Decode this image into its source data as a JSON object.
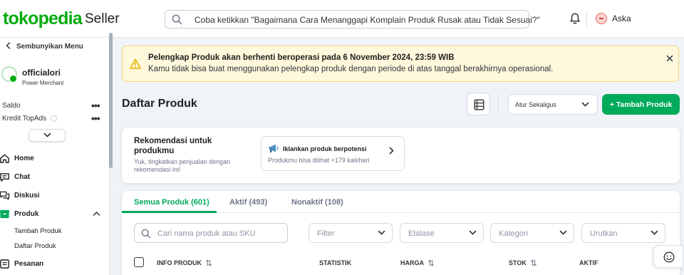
{
  "header": {
    "logo": "tokopedia",
    "logo_suffix": "Seller",
    "search_placeholder": "Coba ketikkan \"Bagaimana Cara Menanggapi Komplain Produk Rusak atau Tidak Sesuai?\"",
    "user_name": "Aska",
    "icons": [
      "search-icon",
      "bell-icon",
      "avatar"
    ]
  },
  "sidebar": {
    "hide_label": "Sembunyikan Menu",
    "shop_name": "officialori",
    "shop_tier": "Power Merchant",
    "saldo_label": "Saldo",
    "kredit_label": "Kredit TopAds",
    "nav": [
      {
        "label": "Home",
        "icon": "home-icon"
      },
      {
        "label": "Chat",
        "icon": "chat-icon"
      },
      {
        "label": "Diskusi",
        "icon": "discussion-icon"
      },
      {
        "label": "Produk",
        "icon": "product-box-icon",
        "expanded": true
      },
      {
        "label": "Pesanan",
        "icon": "order-icon"
      }
    ],
    "sub_items": [
      "Tambah Produk",
      "Daftar Produk"
    ],
    "colors": {
      "brand": "#03ac0e",
      "active_icon": "#00aa5b"
    }
  },
  "alert": {
    "title": "Pelengkap Produk akan berhenti beroperasi pada 6 November 2024, 23:59 WIB",
    "description": "Kamu tidak bisa buat menggunakan pelengkap produk dengan periode di atas tanggal berakhirnya operasional.",
    "colors": {
      "background": "#fff8dc",
      "border": "#f5d775",
      "icon": "#e7b400"
    }
  },
  "page": {
    "title": "Daftar Produk",
    "bulk_action": "Atur Sekaligus",
    "add_button": "+ Tambah Produk"
  },
  "recommendation": {
    "title": "Rekomendasi untuk produkmu",
    "subtitle": "Yuk, tingkatkan penjualan dengan rekomendasi ini!",
    "promo_title": "Iklankan produk berpotensi",
    "promo_desc": "Produkmu bisa dilihat +179 kali/hari"
  },
  "products": {
    "tabs": [
      {
        "label": "Semua Produk (601)",
        "active": true
      },
      {
        "label": "Aktif (493)",
        "active": false
      },
      {
        "label": "Nonaktif (108)",
        "active": false
      }
    ],
    "search_placeholder": "Cari nama produk atau SKU",
    "filters": [
      "Filter",
      "Etalase",
      "Kategori",
      "Urutkan"
    ],
    "columns": [
      "INFO PRODUK",
      "STATISTIK",
      "HARGA",
      "STOK",
      "AKTIF"
    ]
  }
}
